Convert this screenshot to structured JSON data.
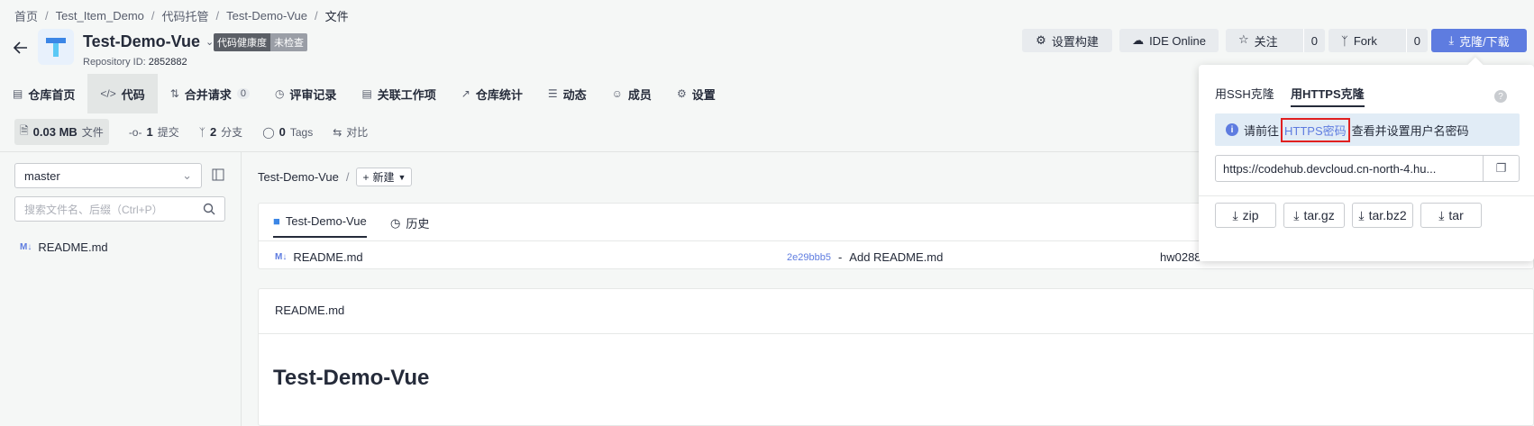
{
  "breadcrumb": {
    "items": [
      "首页",
      "Test_Item_Demo",
      "代码托管",
      "Test-Demo-Vue"
    ],
    "current": "文件"
  },
  "repo": {
    "name": "Test-Demo-Vue",
    "health_label": "代码健康度",
    "health_status": "未检查",
    "id_label": "Repository ID:",
    "id_value": "2852882"
  },
  "actions": {
    "build": "设置构建",
    "ide": "IDE Online",
    "watch": "关注",
    "watch_count": "0",
    "fork": "Fork",
    "fork_count": "0",
    "clone": "克隆/下载"
  },
  "tabs": [
    {
      "label": "仓库首页"
    },
    {
      "label": "代码"
    },
    {
      "label": "合并请求",
      "count": "0"
    },
    {
      "label": "评审记录"
    },
    {
      "label": "关联工作项"
    },
    {
      "label": "仓库统计"
    },
    {
      "label": "动态"
    },
    {
      "label": "成员"
    },
    {
      "label": "设置"
    }
  ],
  "stats": {
    "size": "0.03 MB",
    "size_label": "文件",
    "commits": "1",
    "commits_label": "提交",
    "branches": "2",
    "branches_label": "分支",
    "tags": "0",
    "tags_label": "Tags",
    "compare_label": "对比"
  },
  "sidebar": {
    "branch": "master",
    "search_placeholder": "搜索文件名、后缀（Ctrl+P）",
    "files": [
      "README.md"
    ]
  },
  "main": {
    "path": "Test-Demo-Vue",
    "new_label": "新建",
    "subtabs": [
      "Test-Demo-Vue",
      "历史"
    ],
    "file": "README.md",
    "commit_hash": "2e29bbb5",
    "commit_sep": "-",
    "commit_msg": "Add README.md",
    "commit_author": "hw0288",
    "readme_label": "README.md",
    "readme_heading": "Test-Demo-Vue"
  },
  "clone_popover": {
    "tab_ssh": "用SSH克隆",
    "tab_https": "用HTTPS克隆",
    "notice_pre": "请前往",
    "notice_link": "HTTPS密码",
    "notice_post": "查看并设置用户名密码",
    "url": "https://codehub.devcloud.cn-north-4.hu...",
    "downloads": [
      "zip",
      "tar.gz",
      "tar.bz2",
      "tar"
    ]
  }
}
